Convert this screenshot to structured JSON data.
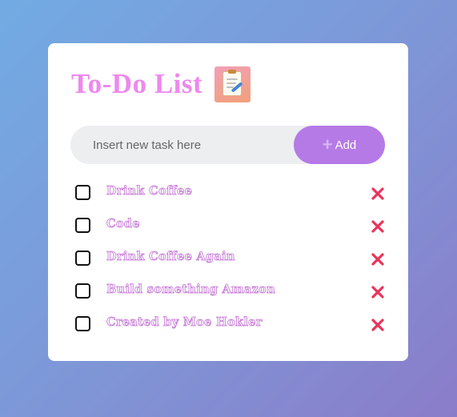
{
  "app": {
    "title": "To-Do List",
    "title_icon": "notepad-pencil-icon"
  },
  "input": {
    "value": "",
    "placeholder": "Insert new task here"
  },
  "add_button": {
    "icon": "plus-icon",
    "label": "Add"
  },
  "tasks": [
    {
      "text": "Drink Coffee",
      "checked": false
    },
    {
      "text": "Code",
      "checked": false
    },
    {
      "text": "Drink Coffee Again",
      "checked": false
    },
    {
      "text": "Build something Amazon",
      "checked": false
    },
    {
      "text": "Created by Moe Hokler",
      "checked": false
    }
  ],
  "colors": {
    "title": "#ee88ee",
    "accent": "#b57ae6",
    "delete": "#e8345c",
    "card": "#ffffff",
    "background_start": "#72abe3",
    "background_end": "#8b7cca"
  }
}
